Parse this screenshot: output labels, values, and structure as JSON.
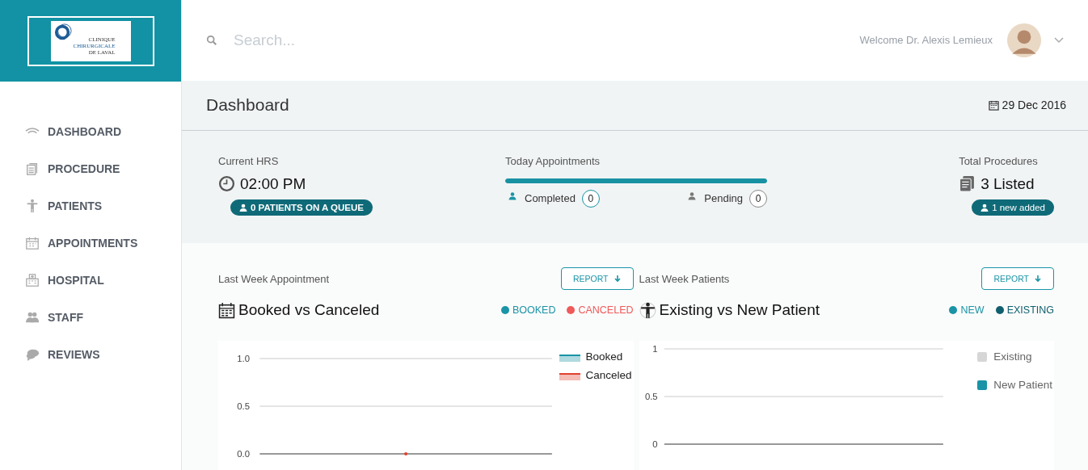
{
  "logo": {
    "lines": [
      "CLINIQUE",
      "CHIRURGICALE",
      "DE LAVAL"
    ]
  },
  "search": {
    "placeholder": "Search..."
  },
  "user": {
    "welcome": "Welcome Dr. Alexis Lemieux"
  },
  "sidebar": {
    "items": [
      {
        "label": "DASHBOARD"
      },
      {
        "label": "PROCEDURE"
      },
      {
        "label": "PATIENTS"
      },
      {
        "label": "APPOINTMENTS"
      },
      {
        "label": "HOSPITAL"
      },
      {
        "label": "STAFF"
      },
      {
        "label": "REVIEWS"
      }
    ]
  },
  "page": {
    "title": "Dashboard",
    "date": "29 Dec 2016"
  },
  "stats": {
    "current": {
      "label": "Current HRS",
      "value": "02:00 PM",
      "badge": "0 PATIENTS ON A QUEUE"
    },
    "today": {
      "label": "Today Appointments",
      "level": 1,
      "completed_label": "Completed",
      "completed": "0",
      "pending_label": "Pending",
      "pending": "0"
    },
    "total": {
      "label": "Total Procedures",
      "value": "3 Listed",
      "badge": "1 new added"
    }
  },
  "panels": [
    {
      "subtitle": "Last Week Appointment",
      "button": "REPORT",
      "title": "Booked vs Canceled",
      "legend": [
        {
          "label": "BOOKED",
          "color": "#1a94a6"
        },
        {
          "label": "CANCELED",
          "color": "#f05a5a"
        }
      ],
      "chart_data": {
        "type": "area",
        "yticks": [
          {
            "value": 0,
            "label": "0.0"
          },
          {
            "value": 0.5,
            "label": "0.5"
          },
          {
            "value": 1,
            "label": "1.0"
          }
        ],
        "ylim": [
          0,
          1
        ],
        "series": [
          {
            "name": "Booked",
            "color": "#1a94a6"
          },
          {
            "name": "Canceled",
            "color": "#e0412f"
          }
        ]
      }
    },
    {
      "subtitle": "Last Week Patients",
      "button": "REPORT",
      "title": "Existing vs New Patient",
      "legend": [
        {
          "label": "NEW",
          "color": "#1a94a6"
        },
        {
          "label": "EXISTING",
          "color": "#0f5f6e"
        }
      ],
      "chart_data": {
        "type": "bar",
        "yticks": [
          {
            "value": 0,
            "label": "0"
          },
          {
            "value": 0.5,
            "label": "0.5"
          },
          {
            "value": 1,
            "label": "1"
          }
        ],
        "ylim": [
          0,
          1
        ],
        "series": [
          {
            "name": "Existing",
            "color": "#d6d6d6"
          },
          {
            "name": "New Patient",
            "color": "#1a94a6"
          }
        ]
      }
    }
  ]
}
